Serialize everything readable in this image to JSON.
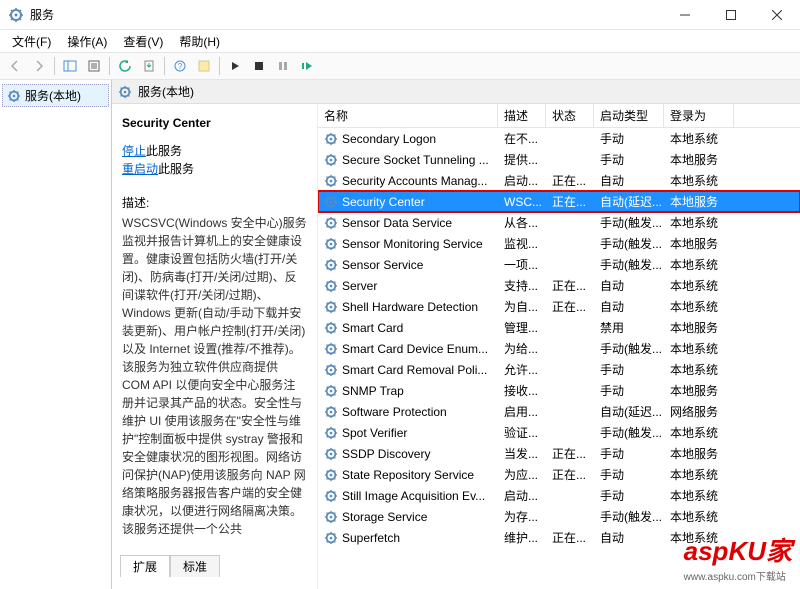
{
  "window": {
    "title": "服务"
  },
  "menu": {
    "file": "文件(F)",
    "action": "操作(A)",
    "view": "查看(V)",
    "help": "帮助(H)"
  },
  "tree": {
    "root": "服务(本地)"
  },
  "detail_header": {
    "label": "服务(本地)"
  },
  "detail": {
    "selected_name": "Security Center",
    "stop_link": "停止",
    "stop_suffix": "此服务",
    "restart_link": "重启动",
    "restart_suffix": "此服务",
    "desc_label": "描述:",
    "desc_text": "WSCSVC(Windows 安全中心)服务监视并报告计算机上的安全健康设置。健康设置包括防火墙(打开/关闭)、防病毒(打开/关闭/过期)、反间谍软件(打开/关闭/过期)、Windows 更新(自动/手动下载并安装更新)、用户帐户控制(打开/关闭)以及 Internet 设置(推荐/不推荐)。该服务为独立软件供应商提供 COM API 以便向安全中心服务注册并记录其产品的状态。安全性与维护 UI 使用该服务在\"安全性与维护\"控制面板中提供 systray 警报和安全健康状况的图形视图。网络访问保护(NAP)使用该服务向 NAP 网络策略服务器报告客户端的安全健康状况，以便进行网络隔离决策。该服务还提供一个公共"
  },
  "columns": {
    "name": "名称",
    "desc": "描述",
    "status": "状态",
    "startup": "启动类型",
    "logon": "登录为"
  },
  "rows": [
    {
      "name": "Secondary Logon",
      "desc": "在不...",
      "status": "",
      "startup": "手动",
      "logon": "本地系统"
    },
    {
      "name": "Secure Socket Tunneling ...",
      "desc": "提供...",
      "status": "",
      "startup": "手动",
      "logon": "本地服务"
    },
    {
      "name": "Security Accounts Manag...",
      "desc": "启动...",
      "status": "正在...",
      "startup": "自动",
      "logon": "本地系统"
    },
    {
      "name": "Security Center",
      "desc": "WSC...",
      "status": "正在...",
      "startup": "自动(延迟...",
      "logon": "本地服务",
      "selected": true
    },
    {
      "name": "Sensor Data Service",
      "desc": "从各...",
      "status": "",
      "startup": "手动(触发...",
      "logon": "本地系统"
    },
    {
      "name": "Sensor Monitoring Service",
      "desc": "监视...",
      "status": "",
      "startup": "手动(触发...",
      "logon": "本地服务"
    },
    {
      "name": "Sensor Service",
      "desc": "一项...",
      "status": "",
      "startup": "手动(触发...",
      "logon": "本地系统"
    },
    {
      "name": "Server",
      "desc": "支持...",
      "status": "正在...",
      "startup": "自动",
      "logon": "本地系统"
    },
    {
      "name": "Shell Hardware Detection",
      "desc": "为自...",
      "status": "正在...",
      "startup": "自动",
      "logon": "本地系统"
    },
    {
      "name": "Smart Card",
      "desc": "管理...",
      "status": "",
      "startup": "禁用",
      "logon": "本地服务"
    },
    {
      "name": "Smart Card Device Enum...",
      "desc": "为给...",
      "status": "",
      "startup": "手动(触发...",
      "logon": "本地系统"
    },
    {
      "name": "Smart Card Removal Poli...",
      "desc": "允许...",
      "status": "",
      "startup": "手动",
      "logon": "本地系统"
    },
    {
      "name": "SNMP Trap",
      "desc": "接收...",
      "status": "",
      "startup": "手动",
      "logon": "本地服务"
    },
    {
      "name": "Software Protection",
      "desc": "启用...",
      "status": "",
      "startup": "自动(延迟...",
      "logon": "网络服务"
    },
    {
      "name": "Spot Verifier",
      "desc": "验证...",
      "status": "",
      "startup": "手动(触发...",
      "logon": "本地系统"
    },
    {
      "name": "SSDP Discovery",
      "desc": "当发...",
      "status": "正在...",
      "startup": "手动",
      "logon": "本地服务"
    },
    {
      "name": "State Repository Service",
      "desc": "为应...",
      "status": "正在...",
      "startup": "手动",
      "logon": "本地系统"
    },
    {
      "name": "Still Image Acquisition Ev...",
      "desc": "启动...",
      "status": "",
      "startup": "手动",
      "logon": "本地系统"
    },
    {
      "name": "Storage Service",
      "desc": "为存...",
      "status": "",
      "startup": "手动(触发...",
      "logon": "本地系统"
    },
    {
      "name": "Superfetch",
      "desc": "维护...",
      "status": "正在...",
      "startup": "自动",
      "logon": "本地系统"
    }
  ],
  "tabs": {
    "extended": "扩展",
    "standard": "标准"
  },
  "watermark": {
    "big": "aspKU家",
    "small": "www.aspku.com下载站"
  }
}
